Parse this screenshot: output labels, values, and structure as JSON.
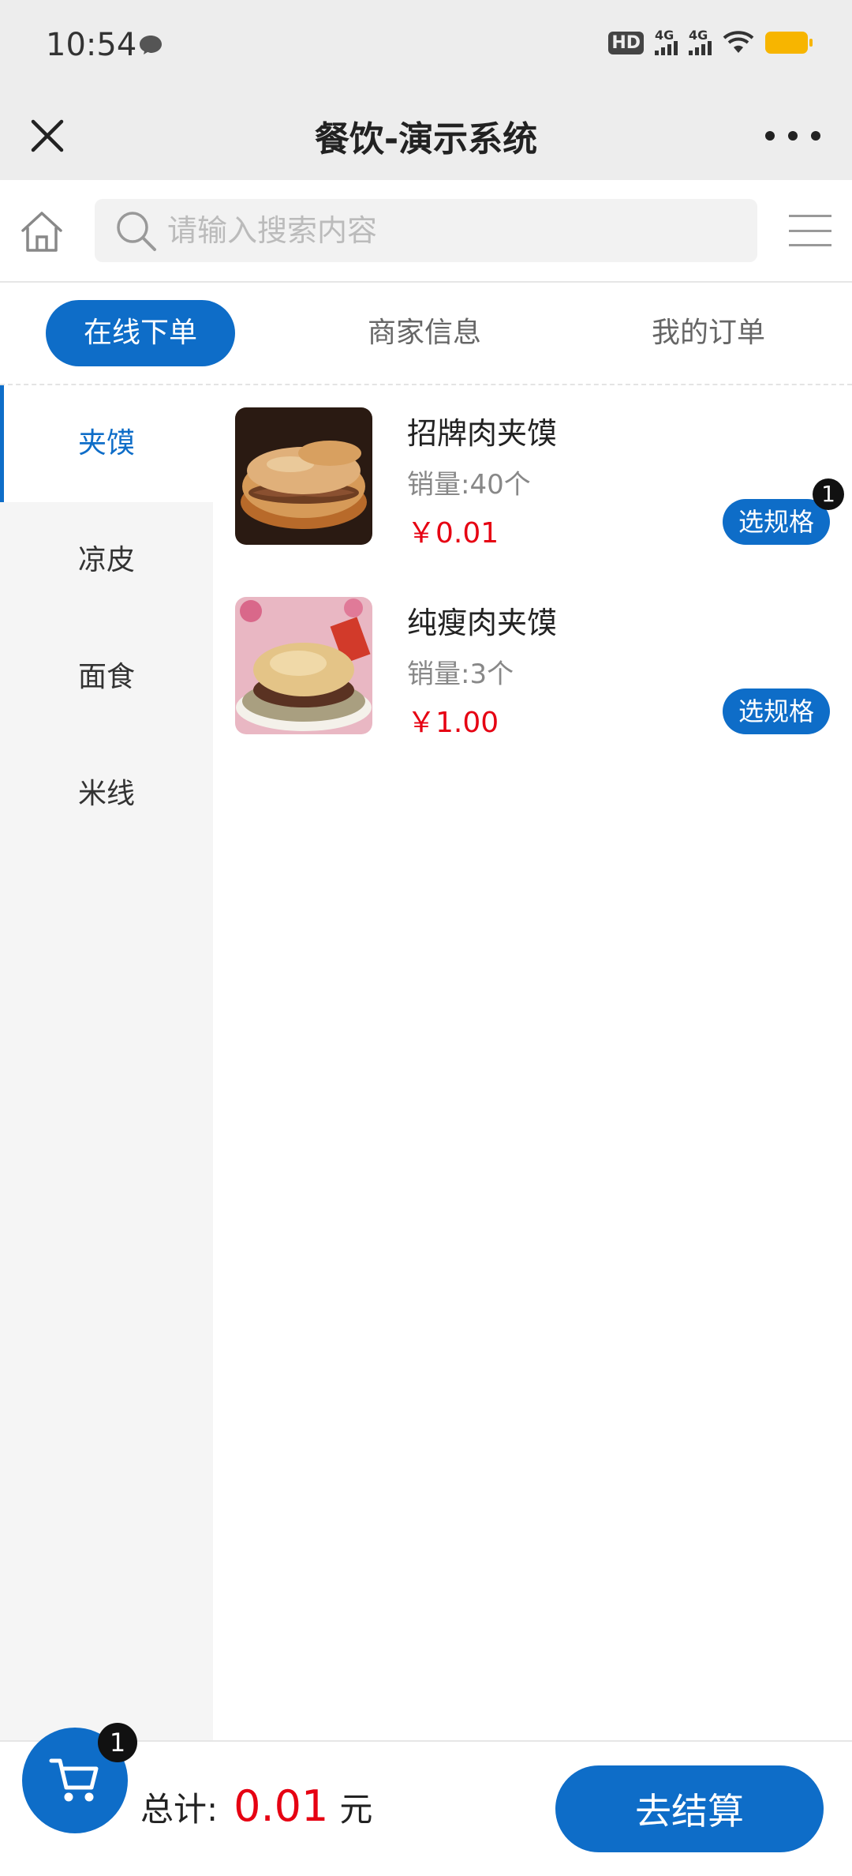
{
  "status_bar": {
    "time": "10:54",
    "network1": "4G",
    "network2": "4G",
    "hd": "HD"
  },
  "title_bar": {
    "title": "餐饮-演示系统"
  },
  "search": {
    "placeholder": "请输入搜索内容",
    "value": ""
  },
  "tabs": [
    {
      "label": "在线下单",
      "active": true
    },
    {
      "label": "商家信息",
      "active": false
    },
    {
      "label": "我的订单",
      "active": false
    }
  ],
  "categories": [
    {
      "label": "夹馍",
      "active": true
    },
    {
      "label": "凉皮",
      "active": false
    },
    {
      "label": "面食",
      "active": false
    },
    {
      "label": "米线",
      "active": false
    }
  ],
  "products": [
    {
      "name": "招牌肉夹馍",
      "sales": "销量:40个",
      "price": "￥0.01",
      "button": "选规格",
      "badge": "1"
    },
    {
      "name": "纯瘦肉夹馍",
      "sales": "销量:3个",
      "price": "￥1.00",
      "button": "选规格",
      "badge": ""
    }
  ],
  "cart": {
    "badge": "1",
    "total_label": "总计:",
    "total_amount": "0.01",
    "currency": "元",
    "checkout_label": "去结算"
  },
  "colors": {
    "accent": "#0e6dc8",
    "price": "#e60012",
    "sidebar_bg": "#f5f5f5",
    "header_bg": "#ededed"
  }
}
